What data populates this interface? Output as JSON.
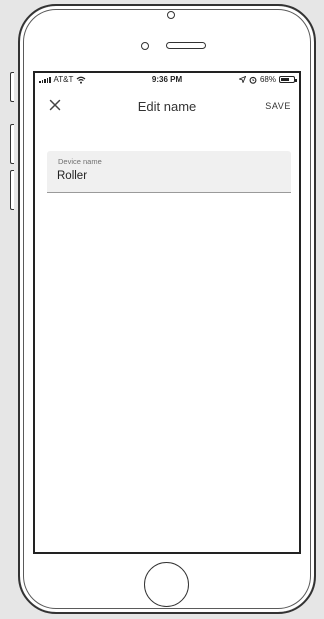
{
  "status_bar": {
    "carrier": "AT&T",
    "time": "9:36 PM",
    "battery_percent": "68%",
    "battery_level": 0.68,
    "icons": [
      "signal-icon",
      "wifi-icon",
      "location-icon",
      "alarm-icon",
      "battery-icon"
    ]
  },
  "app_bar": {
    "title": "Edit name",
    "close_icon": "close-icon",
    "save_label": "SAVE"
  },
  "form": {
    "field_label": "Device name",
    "field_value": "Roller"
  },
  "colors": {
    "field_background": "#f0f0f0",
    "text_primary": "#222222",
    "label_text": "#707070"
  }
}
